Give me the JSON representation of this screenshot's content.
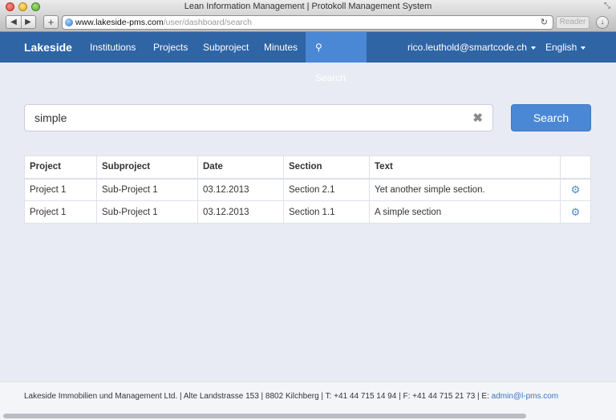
{
  "window": {
    "title": "Lean Information Management | Protokoll Management System",
    "url_host": "www.lakeside-pms.com",
    "url_path": "/user/dashboard/search",
    "reader_label": "Reader",
    "back_glyph": "◀",
    "forward_glyph": "▶",
    "newtab_glyph": "+",
    "reload_glyph": "↻",
    "download_glyph": "↓",
    "resize_glyph": "⤡"
  },
  "navbar": {
    "brand": "Lakeside",
    "items": [
      {
        "label": "Institutions"
      },
      {
        "label": "Projects"
      },
      {
        "label": "Subproject"
      },
      {
        "label": "Minutes"
      },
      {
        "label": "Search",
        "active": true
      }
    ],
    "user": "rico.leuthold@smartcode.ch",
    "language": "English",
    "search_icon_glyph": "⚲"
  },
  "search": {
    "query": "simple",
    "clear_glyph": "✖",
    "button_label": "Search"
  },
  "results": {
    "headers": [
      "Project",
      "Subproject",
      "Date",
      "Section",
      "Text",
      ""
    ],
    "rows": [
      {
        "project": "Project 1",
        "subproject": "Sub-Project 1",
        "date": "03.12.2013",
        "section": "Section 2.1",
        "text": "Yet another simple section."
      },
      {
        "project": "Project 1",
        "subproject": "Sub-Project 1",
        "date": "03.12.2013",
        "section": "Section 1.1",
        "text": "A simple section"
      }
    ],
    "gear_glyph": "⚙"
  },
  "footer": {
    "text": "Lakeside Immobilien und Management Ltd. | Alte Landstrasse 153 | 8802 Kilchberg | T: +41 44 715 14 94 | F: +41 44 715 21 73 | E: ",
    "email": "admin@l-pms.com"
  },
  "colors": {
    "navbar": "#2f64a5",
    "accent": "#4a88d6",
    "page_bg": "#e8ebf3"
  }
}
